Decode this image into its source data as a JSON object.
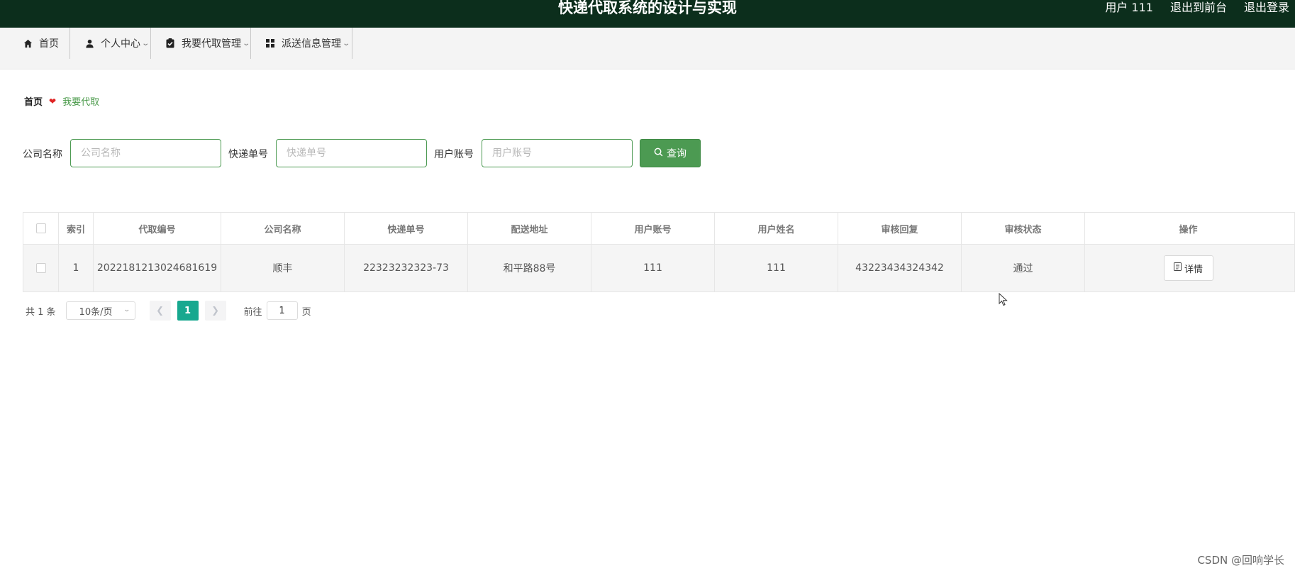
{
  "header": {
    "title": "快递代取系统的设计与实现",
    "user_label": "用户 111",
    "to_frontend": "退出到前台",
    "logout": "退出登录"
  },
  "nav": {
    "items": [
      {
        "label": "首页",
        "icon": "home-icon",
        "dropdown": false
      },
      {
        "label": "个人中心",
        "icon": "user-icon",
        "dropdown": true
      },
      {
        "label": "我要代取管理",
        "icon": "clipboard-icon",
        "dropdown": true
      },
      {
        "label": "派送信息管理",
        "icon": "grid-icon",
        "dropdown": true
      }
    ]
  },
  "breadcrumb": {
    "home": "首页",
    "current": "我要代取"
  },
  "search": {
    "company_label": "公司名称",
    "company_placeholder": "公司名称",
    "tracking_label": "快递单号",
    "tracking_placeholder": "快递单号",
    "account_label": "用户账号",
    "account_placeholder": "用户账号",
    "query_button": "查询"
  },
  "table": {
    "headers": [
      "索引",
      "代取编号",
      "公司名称",
      "快递单号",
      "配送地址",
      "用户账号",
      "用户姓名",
      "审核回复",
      "审核状态",
      "操作"
    ],
    "rows": [
      {
        "index": "1",
        "pickup_no": "2022181213024681619",
        "company": "顺丰",
        "tracking_no": "22323232323-73",
        "address": "和平路88号",
        "account": "111",
        "name": "111",
        "reply": "43223434324342",
        "status": "通过",
        "action": "详情"
      }
    ]
  },
  "pagination": {
    "total": "共 1 条",
    "page_size": "10条/页",
    "current_page": "1",
    "goto_label": "前往",
    "goto_value": "1",
    "page_unit": "页"
  },
  "watermark": "CSDN @回响学长",
  "colors": {
    "header_bg": "#0c2e1c",
    "accent_green": "#4c9a52",
    "page_active": "#17a88f",
    "heart": "#e02424"
  }
}
